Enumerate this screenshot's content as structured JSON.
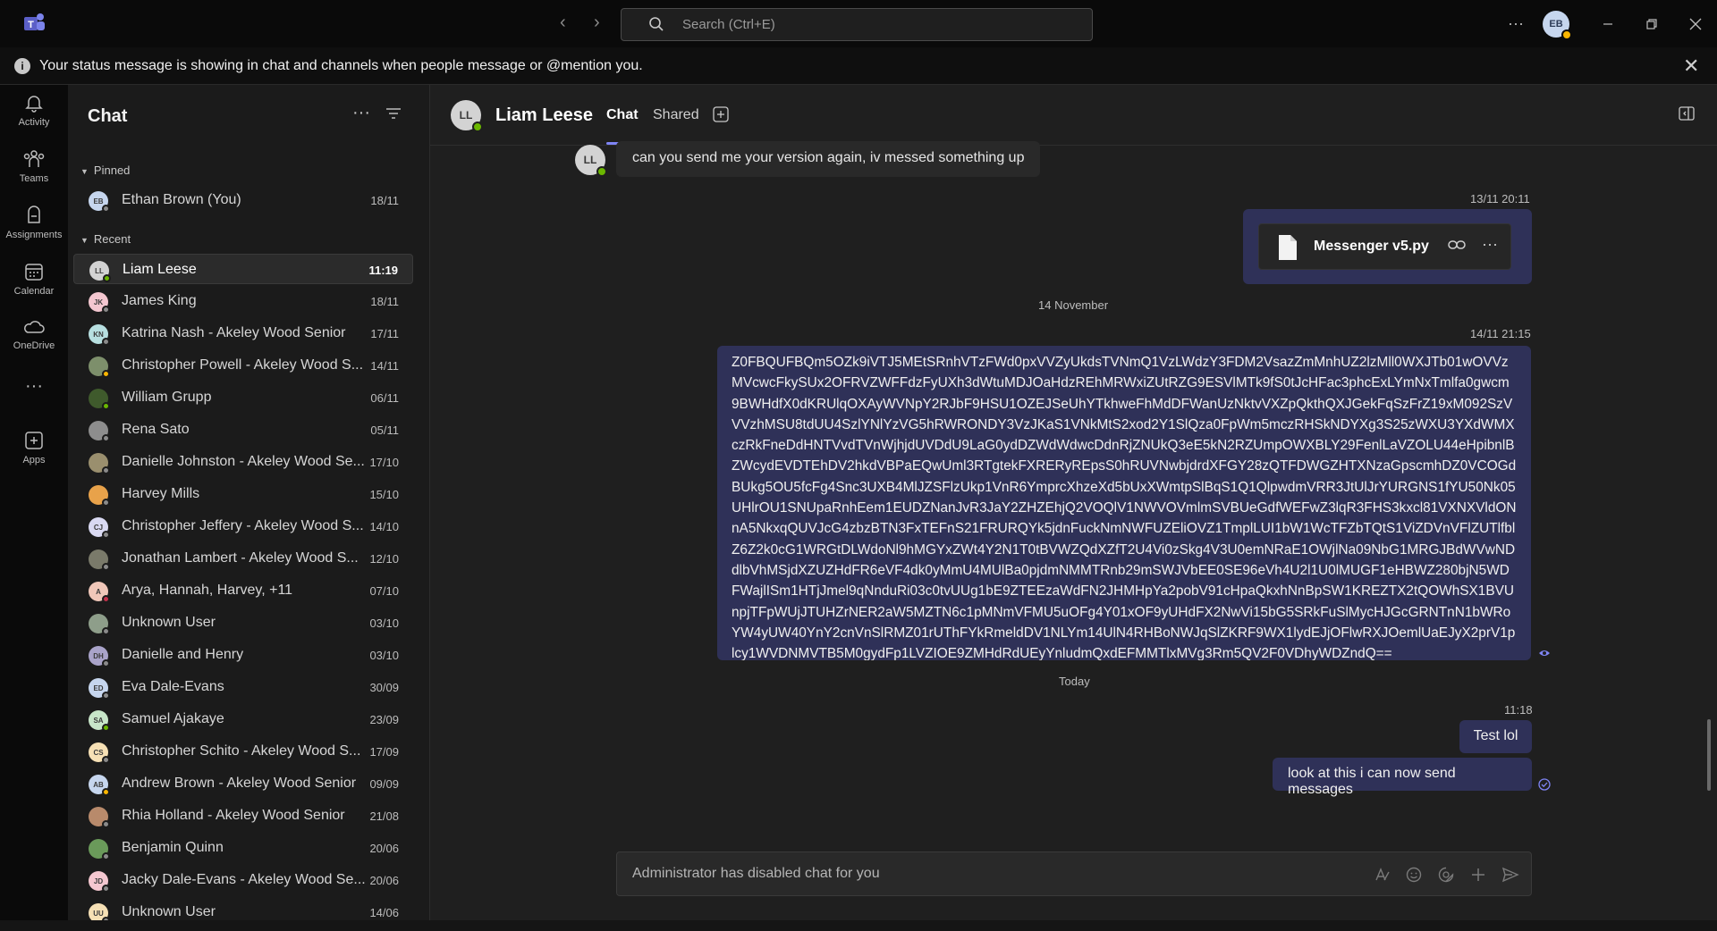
{
  "titlebar": {
    "search_placeholder": "Search (Ctrl+E)",
    "user_initials": "EB",
    "more": "···"
  },
  "banner": {
    "message": "Your status message is showing in chat and channels when people message or @mention you.",
    "info": "i",
    "close": "✕"
  },
  "rail": [
    {
      "label": "Activity",
      "icon": "bell-icon"
    },
    {
      "label": "Teams",
      "icon": "teams-icon"
    },
    {
      "label": "Assignments",
      "icon": "assignments-icon"
    },
    {
      "label": "Calendar",
      "icon": "calendar-icon"
    },
    {
      "label": "OneDrive",
      "icon": "cloud-icon"
    },
    {
      "label": "",
      "icon": "more-icon"
    },
    {
      "label": "Apps",
      "icon": "apps-icon"
    }
  ],
  "sidebar": {
    "title": "Chat",
    "more": "···",
    "pinned_label": "Pinned",
    "recent_label": "Recent",
    "pinned": [
      {
        "name": "Ethan Brown (You)",
        "date": "18/11",
        "initials": "EB",
        "avcolor": "#c6d6ee",
        "status": "#8a8a8a"
      }
    ],
    "recent": [
      {
        "name": "Liam Leese",
        "date": "11:19",
        "initials": "LL",
        "avcolor": "#d3d3d3",
        "status": "#6bb700"
      },
      {
        "name": "James King",
        "date": "18/11",
        "initials": "JK",
        "avcolor": "#f4c7d0",
        "status": "#8a8a8a"
      },
      {
        "name": "Katrina Nash - Akeley Wood Senior",
        "date": "17/11",
        "initials": "KN",
        "avcolor": "#b7dfe0",
        "status": "#8a8a8a"
      },
      {
        "name": "Christopher Powell - Akeley Wood S...",
        "date": "14/11",
        "initials": "",
        "avcolor": "#7d8f6b",
        "status": "#f8b500"
      },
      {
        "name": "William Grupp",
        "date": "06/11",
        "initials": "",
        "avcolor": "#3f5a2c",
        "status": "#6bb700"
      },
      {
        "name": "Rena Sato",
        "date": "05/11",
        "initials": "",
        "avcolor": "#8d8d8d",
        "status": "#8a8a8a"
      },
      {
        "name": "Danielle Johnston - Akeley Wood Se...",
        "date": "17/10",
        "initials": "",
        "avcolor": "#9a8f6e",
        "status": "#8a8a8a"
      },
      {
        "name": "Harvey Mills",
        "date": "15/10",
        "initials": "",
        "avcolor": "#e8a24a",
        "status": "#8a8a8a"
      },
      {
        "name": "Christopher Jeffery - Akeley Wood S...",
        "date": "14/10",
        "initials": "CJ",
        "avcolor": "#d9d9f2",
        "status": "#8a8a8a"
      },
      {
        "name": "Jonathan Lambert - Akeley Wood S...",
        "date": "12/10",
        "initials": "",
        "avcolor": "#7a7a6a",
        "status": "#8a8a8a"
      },
      {
        "name": "Arya, Hannah, Harvey, +11",
        "date": "07/10",
        "initials": "A",
        "avcolor": "#f0c7b9",
        "status": "#c4314b"
      },
      {
        "name": "Unknown User",
        "date": "03/10",
        "initials": "",
        "avcolor": "#8e9e8a",
        "status": "#8a8a8a"
      },
      {
        "name": "Danielle and Henry",
        "date": "03/10",
        "initials": "DH",
        "avcolor": "#a9a3c9",
        "status": "#8a8a8a"
      },
      {
        "name": "Eva Dale-Evans",
        "date": "30/09",
        "initials": "ED",
        "avcolor": "#c6d6ee",
        "status": "#8a8a8a"
      },
      {
        "name": "Samuel Ajakaye",
        "date": "23/09",
        "initials": "SA",
        "avcolor": "#c8e6c9",
        "status": "#6bb700"
      },
      {
        "name": "Christopher Schito - Akeley Wood S...",
        "date": "17/09",
        "initials": "CS",
        "avcolor": "#f6e0b5",
        "status": "#8a8a8a"
      },
      {
        "name": "Andrew Brown - Akeley Wood Senior",
        "date": "09/09",
        "initials": "AB",
        "avcolor": "#c6d6ee",
        "status": "#f8b500"
      },
      {
        "name": "Rhia Holland - Akeley Wood Senior",
        "date": "21/08",
        "initials": "",
        "avcolor": "#b88a6b",
        "status": "#8a8a8a"
      },
      {
        "name": "Benjamin Quinn",
        "date": "20/06",
        "initials": "",
        "avcolor": "#6a9a5a",
        "status": "#8a8a8a"
      },
      {
        "name": "Jacky Dale-Evans - Akeley Wood Se...",
        "date": "20/06",
        "initials": "JD",
        "avcolor": "#f4c7d0",
        "status": "#8a8a8a"
      },
      {
        "name": "Unknown User",
        "date": "14/06",
        "initials": "UU",
        "avcolor": "#f6e0b5",
        "status": "#8a8a8a"
      }
    ]
  },
  "chat": {
    "contact_name": "Liam Leese",
    "contact_initials": "LL",
    "tab_chat": "Chat",
    "tab_shared": "Shared",
    "incoming_message": "can you send me your version again, iv messed something up",
    "ts1": "13/11 20:11",
    "file_name": "Messenger v5.py",
    "file_more": "···",
    "day1": "14 November",
    "ts2": "14/11 21:15",
    "long_message": "Z0FBQUFBQm5OZk9iVTJ5MEtSRnhVTzFWd0pxVVZyUkdsTVNmQ1VzLWdzY3FDM2VsazZmMnhUZ2lzMll0WXJTb01wOVVzMVcwcFkySUx2OFRVZWFFdzFyUXh3dWtuMDJOaHdzREhMRWxiZUtRZG9ESVlMTk9fS0tJcHFac3phcExLYmNxTmlfa0gwcm9BWHdfX0dKRUlqOXAyWVNpY2RJbF9HSU1OZEJSeUhYTkhweFhMdDFWanUzNktvVXZpQkthQXJGekFqSzFrZ19xM092SzVVVzhMSU8tdUU4SzlYNlYzVG5hRWRONDY3VzJKaS1VNkMtS2xod2Y1SlQza0FpWm5mczRHSkNDYXg3S25zWXU3YXdWMXczRkFneDdHNTVvdTVnWjhjdUVDdU9LaG0ydDZWdWdwcDdnRjZNUkQ3eE5kN2RZUmpOWXBLY29FenlLaVZOLU44eHpibnlBZWcydEVDTEhDV2hkdVBPaEQwUml3RTgtekFXRERyREpsS0hRUVNwbjdrdXFGY28zQTFDWGZHTXNzaGpscmhDZ0VCOGdBUkg5OU5fcFg4Snc3UXB4MlJZSFlzUkp1VnR6YmprcXhzeXd5bUxXWmtpSlBqS1Q1QlpwdmVRR3JtUlJrYURGNS1fYU50Nk05UHlrOU1SNUpaRnhEem1EUDZNanJvR3JaY2ZHZEhjQ2VOQlV1NWVOVmlmSVBUeGdfWEFwZ3lqR3FHS3kxcl81VXNXVldONnA5NkxqQUVJcG4zbzBTN3FxTEFnS21FRURQYk5jdnFuckNmNWFUZEliOVZ1TmplLUI1bW1WcTFZbTQtS1ViZDVnVFlZUTlfblZ6Z2k0cG1WRGtDLWdoNl9hMGYxZWt4Y2N1T0tBVWZQdXZfT2U4Vi0zSkg4V3U0emNRaE1OWjlNa09NbG1MRGJBdWVwNDdlbVhMSjdXZUZHdFR6eVF4dk0yMmU4MUlBa0pjdmNMMTRnb29mSWJVbEE0SE96eVh4U2l1U0lMUGF1eHBWZ280bjN5WDFWajlISm1HTjJmel9qNnduRi03c0tvUUg1bE9ZTEEzaWdFN2JHMHpYa2pobV91cHpaQkxhNnBpSW1KREZTX2tQOWhSX1BVUnpjTFpWUjJTUHZrNER2aW5MZTN6c1pMNmVFMU5uOFg4Y01xOF9yUHdFX2NwVi15bG5SRkFuSlMycHJGcGRNTnN1bWRoYW4yUW40YnY2cnVnSlRMZ01rUThFYkRmeldDV1NLYm14UlN4RHBoNWJqSlZKRF9WX1lydEJjOFlwRXJOemlUaEJyX2prV1plcy1WVDNMVTB5M0gydFp1LVZIOE9ZMHdRdUEyYnludmQxdEFMMTlxMVg3Rm5QV2F0VDhyWDZndQ==",
    "day2": "Today",
    "ts3": "11:18",
    "msg_test": "Test lol",
    "msg_send": "look at this i can now send messages",
    "compose_placeholder": "Administrator has disabled chat for you"
  }
}
